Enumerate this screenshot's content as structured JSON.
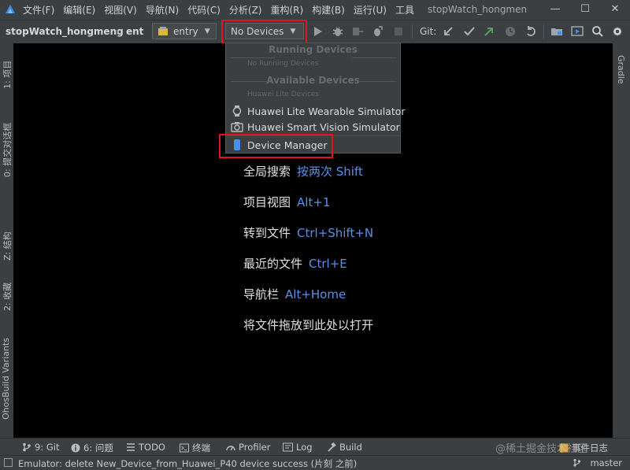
{
  "menubar": {
    "items": [
      "文件(F)",
      "编辑(E)",
      "视图(V)",
      "导航(N)",
      "代码(C)",
      "分析(Z)",
      "重构(R)",
      "构建(B)",
      "运行(U)",
      "工具"
    ],
    "window_title": "stopWatch_hongmen",
    "minimize": "—",
    "maximize": "☐",
    "close": "✕"
  },
  "toolbar": {
    "project_crumb": "stopWatch_hongmeng",
    "module_crumb": "ent",
    "run_config": "entry",
    "device_selector": "No Devices",
    "git_label": "Git:"
  },
  "dropdown": {
    "running_header": "Running Devices",
    "no_running": "No Running Devices",
    "available_header": "Available Devices",
    "lite_group": "Huawei Lite Devices",
    "items": [
      {
        "label": "Huawei Lite Wearable Simulator",
        "icon": "watch-icon"
      },
      {
        "label": "Huawei Smart Vision Simulator",
        "icon": "camera-icon"
      },
      {
        "label": "Device Manager",
        "icon": "phone-icon"
      }
    ]
  },
  "hints": [
    {
      "text": "全局搜索",
      "key": "按两次 Shift"
    },
    {
      "text": "项目视图",
      "key": "Alt+1"
    },
    {
      "text": "转到文件",
      "key": "Ctrl+Shift+N"
    },
    {
      "text": "最近的文件",
      "key": "Ctrl+E"
    },
    {
      "text": "导航栏",
      "key": "Alt+Home"
    },
    {
      "text": "将文件拖放到此处以打开",
      "key": ""
    }
  ],
  "left_tabs": [
    "1: 项目",
    "0: 提交对话框",
    "Z: 结构",
    "2: 收藏",
    "OhosBuild Variants"
  ],
  "right_tabs": [
    "Gradle"
  ],
  "bottom_tools": [
    "9: Git",
    "6: 问题",
    "TODO",
    "终端",
    "Profiler",
    "Log",
    "Build",
    "事件日志"
  ],
  "status": {
    "message": "Emulator: delete New_Device_from_Huawei_P40 device success (片刻 之前)",
    "branch": "master"
  },
  "watermark": "@稀土掘金技术社区",
  "colors": {
    "accent": "#5c8fe6",
    "highlight": "#e0141a",
    "run_green": "#59a869"
  }
}
